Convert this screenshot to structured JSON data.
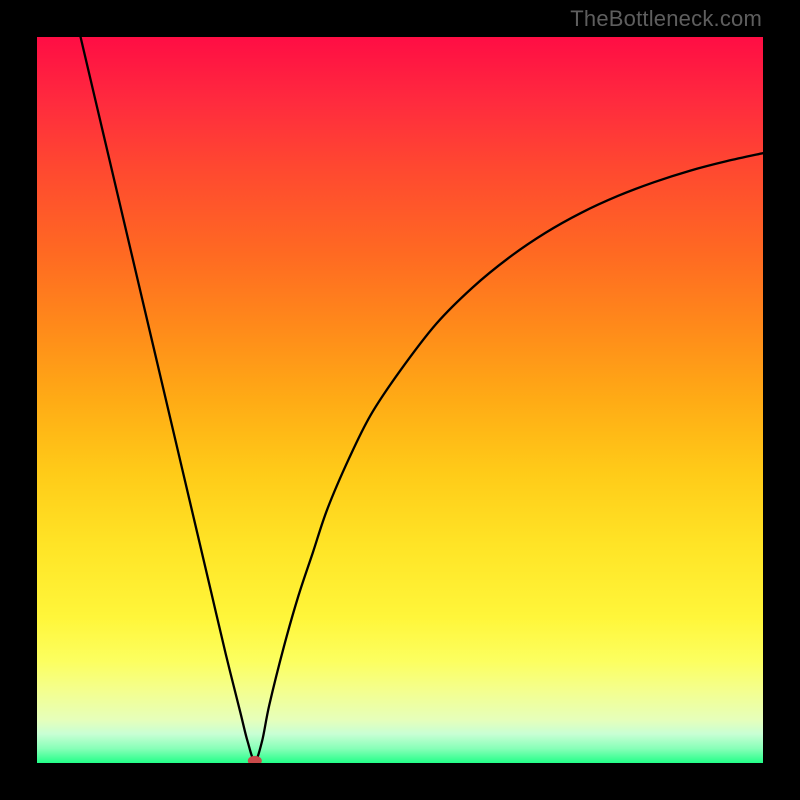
{
  "watermark": "TheBottleneck.com",
  "curve": {
    "stroke": "#000000",
    "stroke_width": 2.3,
    "marker": {
      "fill": "#c94a4a",
      "rx": 7,
      "ry": 5
    }
  },
  "chart_data": {
    "type": "line",
    "title": "",
    "xlabel": "",
    "ylabel": "",
    "xlim": [
      0,
      100
    ],
    "ylim": [
      0,
      100
    ],
    "x": [
      6,
      8,
      10,
      12,
      14,
      16,
      18,
      20,
      22,
      24,
      26,
      28,
      29,
      30,
      31,
      32,
      34,
      36,
      38,
      40,
      43,
      46,
      50,
      55,
      60,
      65,
      70,
      75,
      80,
      85,
      90,
      95,
      100
    ],
    "values": [
      100,
      91.5,
      83,
      74.5,
      66,
      57.5,
      49,
      40.5,
      32,
      23.5,
      15,
      7,
      3,
      0.3,
      3,
      8,
      16,
      23,
      29,
      35,
      42,
      48,
      54,
      60.5,
      65.5,
      69.6,
      73,
      75.8,
      78.1,
      80,
      81.6,
      82.9,
      84
    ],
    "minimum_x": 30,
    "minimum_y": 0.3,
    "background_gradient": {
      "top": "#ff0d44",
      "bottom": "#22ff88"
    },
    "colors": {
      "curve": "#000000",
      "marker": "#c94a4a",
      "frame": "#000000"
    }
  }
}
